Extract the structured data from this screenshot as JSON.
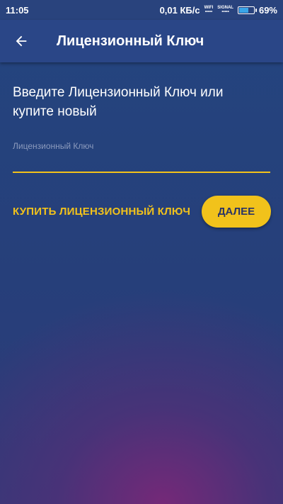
{
  "status_bar": {
    "time": "11:05",
    "network_speed": "0,01 КБ/с",
    "wifi_label": "WIFI",
    "signal_label": "SIGNAL",
    "signal_dots": "•••••",
    "battery_percent": "69%",
    "battery_level": 0.69
  },
  "toolbar": {
    "back_icon": "arrow-left-icon",
    "title": "Лицензионный Ключ"
  },
  "main": {
    "prompt": "Введите Лицензионный Ключ или купите новый",
    "field_label": "Лицензионный Ключ",
    "field_value": "",
    "buy_link": "КУПИТЬ ЛИЦЕНЗИОННЫЙ КЛЮЧ",
    "next_button": "ДАЛЕЕ"
  },
  "colors": {
    "accent": "#f1c21b",
    "background": "#263f7a",
    "toolbar": "#2a4687"
  }
}
